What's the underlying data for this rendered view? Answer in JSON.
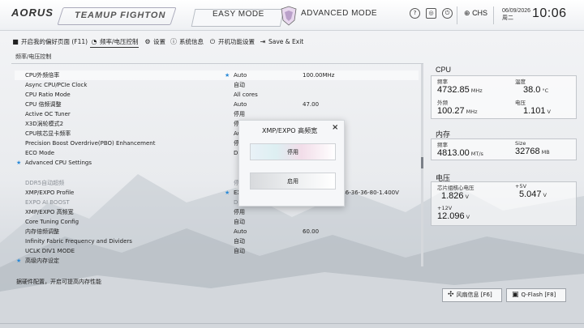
{
  "header": {
    "brand": "AORUS",
    "team_logo": "TEAMUP FIGHTON",
    "easy_mode": "EASY MODE",
    "advanced_mode": "ADVANCED MODE",
    "lang": "CHS",
    "date": "06/09/2026",
    "weekday": "周二",
    "time": "10:06",
    "icons": [
      "help-icon",
      "screenshot-icon",
      "power-icon",
      "globe-icon"
    ]
  },
  "nav": {
    "tabs": [
      {
        "label": "开启我的偏好页面 (F11)",
        "icon": "favorite-icon"
      },
      {
        "label": "频率/电压控制",
        "icon": "speedometer-icon"
      },
      {
        "label": "设置",
        "icon": "gear-icon"
      },
      {
        "label": "系统信息",
        "icon": "info-icon"
      },
      {
        "label": "开机功能设置",
        "icon": "power-icon"
      },
      {
        "label": "Save & Exit",
        "icon": "exit-icon"
      }
    ]
  },
  "page_subtitle": "频率/电压控制",
  "settings": [
    {
      "label": "CPU外频倍率",
      "value": "Auto",
      "value2": "100.00MHz",
      "starred_value": true,
      "highlight": true
    },
    {
      "label": "Async CPU/PCIe Clock",
      "value": "自动"
    },
    {
      "label": "CPU Ratio Mode",
      "value": "All cores"
    },
    {
      "label": "CPU 倍频调整",
      "value": "Auto",
      "value2": "47.00"
    },
    {
      "label": "Active OC Tuner",
      "value": "停用"
    },
    {
      "label": "X3D涡轮模式2",
      "value": "停用"
    },
    {
      "label": "CPU核芯显卡频率",
      "value": "Auto"
    },
    {
      "label": "Precision Boost Overdrive(PBO) Enhancement",
      "value": "停用"
    },
    {
      "label": "ECO Mode",
      "value": "Disabled"
    },
    {
      "label": "Advanced CPU Settings",
      "value": "",
      "starred_label": true
    },
    {
      "label": "DDR5自动超频",
      "value": "停用",
      "dim": true
    },
    {
      "label": "XMP/EXPO Profile",
      "value": "EXPO I",
      "value2": "6000-36-36-36-80-1.400V",
      "starred_value": true
    },
    {
      "label": "EXPO AI BOOST",
      "value": "Disabled",
      "dim": true
    },
    {
      "label": "XMP/EXPO 高频宽",
      "value": "停用"
    },
    {
      "label": "Core Tuning Config",
      "value": "自动"
    },
    {
      "label": "内存倍频调整",
      "value": "Auto",
      "value2": "60.00"
    },
    {
      "label": "Infinity Fabric Frequency and Dividers",
      "value": "自动"
    },
    {
      "label": "UCLK DIV1 MODE",
      "value": "自动"
    },
    {
      "label": "高级内存设定",
      "value": "",
      "starred_label": true
    }
  ],
  "right_panel": {
    "cpu": {
      "title": "CPU",
      "freq_label": "频率",
      "freq_value": "4732.85",
      "freq_unit": "MHz",
      "temp_label": "温度",
      "temp_value": "38.0",
      "temp_unit": "°C",
      "bclk_label": "外频",
      "bclk_value": "100.27",
      "bclk_unit": "MHz",
      "volt_label": "电压",
      "volt_value": "1.101",
      "volt_unit": "V"
    },
    "memory": {
      "title": "内存",
      "freq_label": "频率",
      "freq_value": "4813.00",
      "freq_unit": "MT/s",
      "size_label": "Size",
      "size_value": "32768",
      "size_unit": "MB"
    },
    "voltage": {
      "title": "电压",
      "chipset_label": "芯片组核心电压",
      "chipset_value": "1.826",
      "chipset_unit": "V",
      "p5v_label": "+5V",
      "p5v_value": "5.047",
      "p5v_unit": "V",
      "p12v_label": "+12V",
      "p12v_value": "12.096",
      "p12v_unit": "V"
    }
  },
  "hint": "据硬件配置，开启可提高内存性能",
  "bottom_buttons": {
    "fan": "风扇信息 [F6]",
    "qflash": "Q-Flash [F8]"
  },
  "dialog": {
    "title": "XMP/EXPO 高频宽",
    "option1": "停用",
    "option2": "启用"
  },
  "accent_color": "#2a8ad8"
}
